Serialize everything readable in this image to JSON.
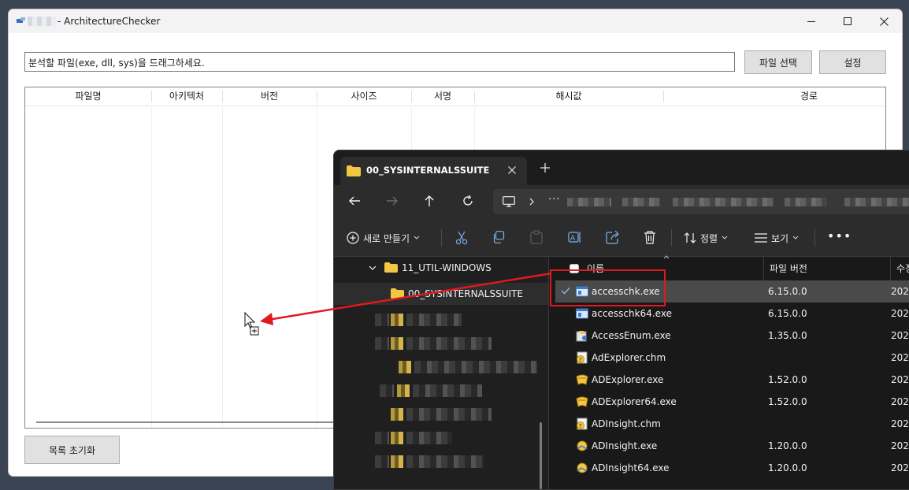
{
  "app": {
    "title": "- ArchitectureChecker",
    "drop_hint": "분석할 파일(exe, dll, sys)을 드래그하세요.",
    "select_file_button": "파일 선택",
    "settings_button": "설정",
    "reset_button": "목록 초기화",
    "columns": [
      "파일명",
      "아키텍처",
      "버전",
      "사이즈",
      "서명",
      "해시값",
      "경로"
    ]
  },
  "explorer": {
    "tab_title": "00_SYSINTERNALSSUITE",
    "new_button": "새로 만들기",
    "sort_button": "정렬",
    "view_button": "보기",
    "tree": {
      "parent": "11_UTIL-WINDOWS",
      "current": "00_SYSINTERNALSSUITE"
    },
    "list_headers": {
      "name": "이름",
      "version": "파일 버전",
      "modified": "수정"
    },
    "files": [
      {
        "name": "accesschk.exe",
        "version": "6.15.0.0",
        "date": "202"
      },
      {
        "name": "accesschk64.exe",
        "version": "6.15.0.0",
        "date": "202"
      },
      {
        "name": "AccessEnum.exe",
        "version": "1.35.0.0",
        "date": "202"
      },
      {
        "name": "AdExplorer.chm",
        "version": "",
        "date": "202"
      },
      {
        "name": "ADExplorer.exe",
        "version": "1.52.0.0",
        "date": "202"
      },
      {
        "name": "ADExplorer64.exe",
        "version": "1.52.0.0",
        "date": "202"
      },
      {
        "name": "ADInsight.chm",
        "version": "",
        "date": "202"
      },
      {
        "name": "ADInsight.exe",
        "version": "1.20.0.0",
        "date": "202"
      },
      {
        "name": "ADInsight64.exe",
        "version": "1.20.0.0",
        "date": "202"
      }
    ],
    "file_icons": [
      "exe-window-icon",
      "exe-window-icon",
      "accessenum-icon",
      "chm-help-icon",
      "adexplorer-icon",
      "adexplorer-icon",
      "chm-help-icon",
      "adinsight-icon",
      "adinsight-icon"
    ],
    "selected_file": "accesschk.exe"
  },
  "colors": {
    "annotation": "#e0191f",
    "explorer_bg": "#191919",
    "folder": "#f2c744"
  }
}
